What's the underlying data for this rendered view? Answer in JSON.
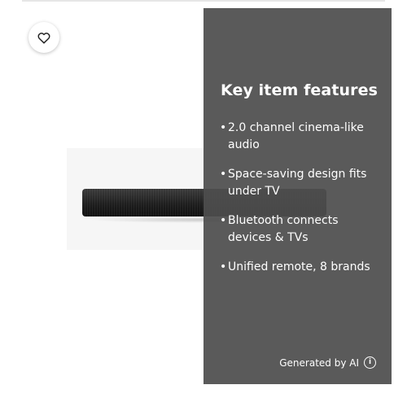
{
  "favorite": {
    "icon": "heart-outline-icon"
  },
  "product": {
    "image": "soundbar-product-image"
  },
  "features_panel": {
    "title": "Key item features",
    "items": [
      "2.0 channel cinema-like audio",
      "Space-saving design fits under TV",
      "Bluetooth connects devices & TVs",
      "Unified remote, 8 brands"
    ],
    "bullet": "•",
    "footer": "Generated by AI",
    "info_icon": "info-icon",
    "info_glyph": "i"
  },
  "colors": {
    "panel_background": "#4e4e4e",
    "panel_text": "#ffffff",
    "page_background": "#ffffff"
  }
}
